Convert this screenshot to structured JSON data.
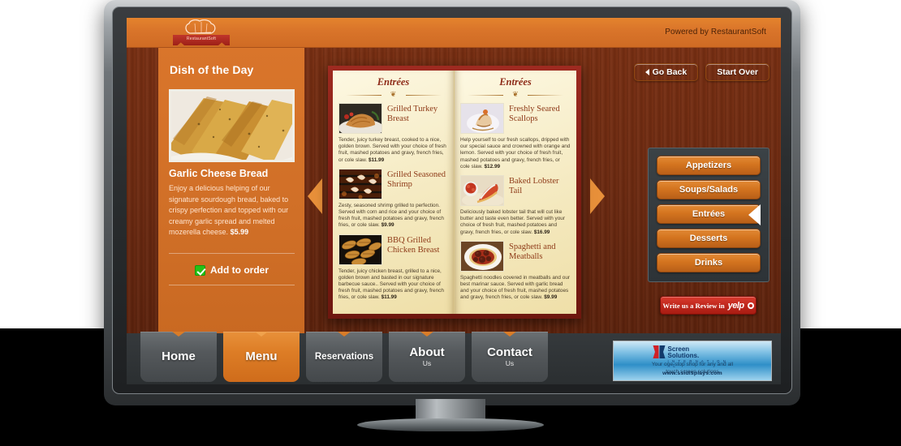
{
  "header": {
    "logo_name": "RestaurantSoft",
    "ribbon_text": "RestaurantSoft",
    "powered_by": "Powered by RestaurantSoft"
  },
  "dish_of_day": {
    "panel_title": "Dish of the Day",
    "name": "Garlic Cheese Bread",
    "description": "Enjoy a delicious helping of our signature sourdough bread, baked to crispy perfection and topped with our creamy garlic spread and melted mozerella cheese.",
    "price": "$5.99",
    "add_label": "Add to order"
  },
  "top_buttons": {
    "go_back": "Go Back",
    "start_over": "Start Over"
  },
  "categories": {
    "items": [
      {
        "label": "Appetizers",
        "selected": false
      },
      {
        "label": "Soups/Salads",
        "selected": false
      },
      {
        "label": "Entrées",
        "selected": true
      },
      {
        "label": "Desserts",
        "selected": false
      },
      {
        "label": "Drinks",
        "selected": false
      }
    ]
  },
  "yelp": {
    "text": "Write us a Review in",
    "brand": "yelp"
  },
  "menu_book": {
    "left_page": {
      "heading": "Entrées",
      "items": [
        {
          "name": "Grilled Turkey Breast",
          "description": "Tender, juicy turkey breast, cooked to a nice, golden brown. Served with your choice of fresh fruit, mashed potatoes and gravy, french fries, or cole slaw.",
          "price": "$11.99"
        },
        {
          "name": "Grilled Seasoned Shrimp",
          "description": "Zesty, seasoned shrimp grilled to perfection. Served with corn and rice and your choice of fresh fruit, mashed potatoes and gravy, french fries, or cole slaw.",
          "price": "$9.99"
        },
        {
          "name": "BBQ Grilled Chicken Breast",
          "description": "Tender, juicy chicken breast, grilled to a nice, golden brown and basted in our signature barbecue sauce.. Served with your choice of fresh fruit, mashed potatoes and gravy, french fries, or cole slaw.",
          "price": "$11.99"
        }
      ]
    },
    "right_page": {
      "heading": "Entrées",
      "items": [
        {
          "name": "Freshly Seared Scallops",
          "description": "Help yourself to our fresh scallops, dripped with our special sauce and crowned with orange and lemon. Served with your choice of fresh fruit, mashed potatoes and gravy, french fries, or cole slaw.",
          "price": "$12.99"
        },
        {
          "name": "Baked Lobster Tail",
          "description": "Deliciously baked lobster tail that will cut like butter and taste even better. Served with your choice of fresh fruit, mashed potatoes and gravy, french fries, or cole slaw.",
          "price": "$16.99"
        },
        {
          "name": "Spaghetti and Meatballs",
          "description": "Spaghetti noodles covered in meatballs and our best marinar sauce. Served with garlic bread and your choice of fresh fruit, mashed potatoes and gravy, french fries, or cole slaw.",
          "price": "$9.99"
        }
      ]
    }
  },
  "footer_tabs": [
    {
      "line1": "Home",
      "line2": "",
      "active": false
    },
    {
      "line1": "Menu",
      "line2": "",
      "active": true
    },
    {
      "line1": "Reservations",
      "line2": "",
      "active": false
    },
    {
      "line1": "About",
      "line2": "Us",
      "active": false
    },
    {
      "line1": "Contact",
      "line2": "Us",
      "active": false
    }
  ],
  "ad": {
    "brand_line1": "Screen",
    "brand_line2": "Solutions.",
    "brand_line3": "I N T E R N A T I O N A L",
    "tagline_line1": "Your one-stop shop for any and all",
    "tagline_line2": "touch screen solutions",
    "url": "www.ssidisplays.com"
  },
  "colors": {
    "brand_orange": "#d4741f",
    "panel_orange": "#d06f27",
    "wood_brown": "#6e2a10",
    "book_red": "#7d1d14",
    "page_cream": "#f6ecc6",
    "yelp_red": "#c0281d",
    "tab_gray": "#55595c"
  }
}
